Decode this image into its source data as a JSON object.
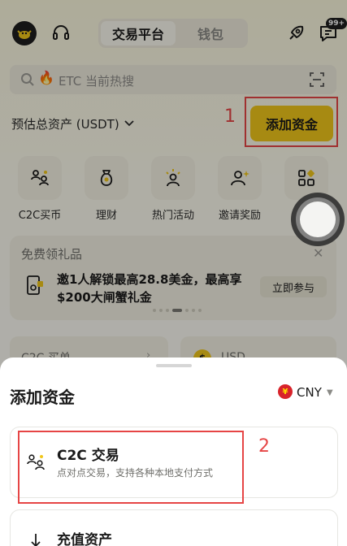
{
  "header": {
    "tabs": [
      {
        "label": "交易平台",
        "active": true
      },
      {
        "label": "钱包",
        "active": false
      }
    ],
    "notification_badge": "99+"
  },
  "search": {
    "hot_label": "ETC 当前热搜"
  },
  "assets": {
    "label": "预估总资产 (USDT)",
    "add_funds_button": "添加资金"
  },
  "quick_actions": [
    {
      "label": "C2C买币",
      "icon": "c2c-users-icon"
    },
    {
      "label": "理财",
      "icon": "money-bag-icon"
    },
    {
      "label": "热门活动",
      "icon": "sparkle-person-icon"
    },
    {
      "label": "邀请奖励",
      "icon": "invite-person-icon"
    },
    {
      "label": "",
      "icon": "more-grid-icon"
    }
  ],
  "promo": {
    "title": "免费领礼品",
    "text": "邀1人解锁最高28.8美金，最高享$200大闸蟹礼金",
    "join_button": "立即参与"
  },
  "lower_cards": {
    "left_label": "C2C 买单",
    "right_label": "USD",
    "right_icon_text": "$"
  },
  "sheet": {
    "title": "添加资金",
    "currency": "CNY",
    "currency_symbol": "¥",
    "options": [
      {
        "title": "C2C 交易",
        "subtitle": "点对点交易，支持各种本地支付方式",
        "icon": "c2c-users-icon"
      },
      {
        "title": "充值资产",
        "subtitle": "",
        "icon": "deposit-arrow-icon"
      }
    ]
  },
  "annotations": {
    "marker_1": "1",
    "marker_2": "2"
  },
  "colors": {
    "accent": "#f0c61a",
    "annotation_red": "#e64545",
    "background": "#fbfaf3"
  }
}
